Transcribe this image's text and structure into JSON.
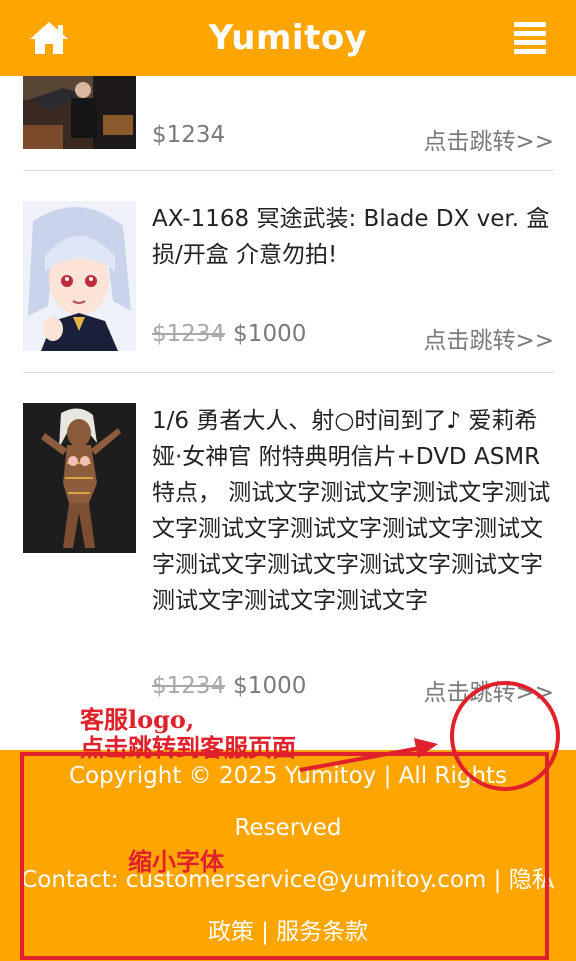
{
  "header": {
    "brand": "Yumitoy",
    "home_icon": "home-icon",
    "menu_icon": "hamburger-menu-icon"
  },
  "products": [
    {
      "price": "$1234",
      "link_text": "点击跳转>>"
    },
    {
      "title": "AX-1168 冥途武装: Blade DX ver. 盒损/开盒 介意勿拍!",
      "old_price": "$1234",
      "price": "$1000",
      "link_text": "点击跳转>>"
    },
    {
      "title": "1/6 勇者大人、射○时间到了♪ 爱莉希娅·女神官 附特典明信片+DVD ASMR特点， 测试文字测试文字测试文字测试文字测试文字测试文字测试文字测试文字测试文字测试文字测试文字测试文字测试文字测试文字测试文字",
      "old_price": "$1234",
      "price": "$1000",
      "link_text": "点击跳转>>"
    }
  ],
  "footer": {
    "line1": "Copyright © 2025 Yumitoy | All Rights",
    "line2": "Reserved",
    "line3": "Contact: customerservice@yumitoy.com | 隐私",
    "line4": "政策 | 服务条款"
  },
  "annotations": {
    "note_logo_line1": "客服logo,",
    "note_logo_line2": "点击跳转到客服页面",
    "note_font": "缩小字体"
  },
  "colors": {
    "brand_orange": "#ffa500",
    "annotation_red": "#e0202a"
  }
}
